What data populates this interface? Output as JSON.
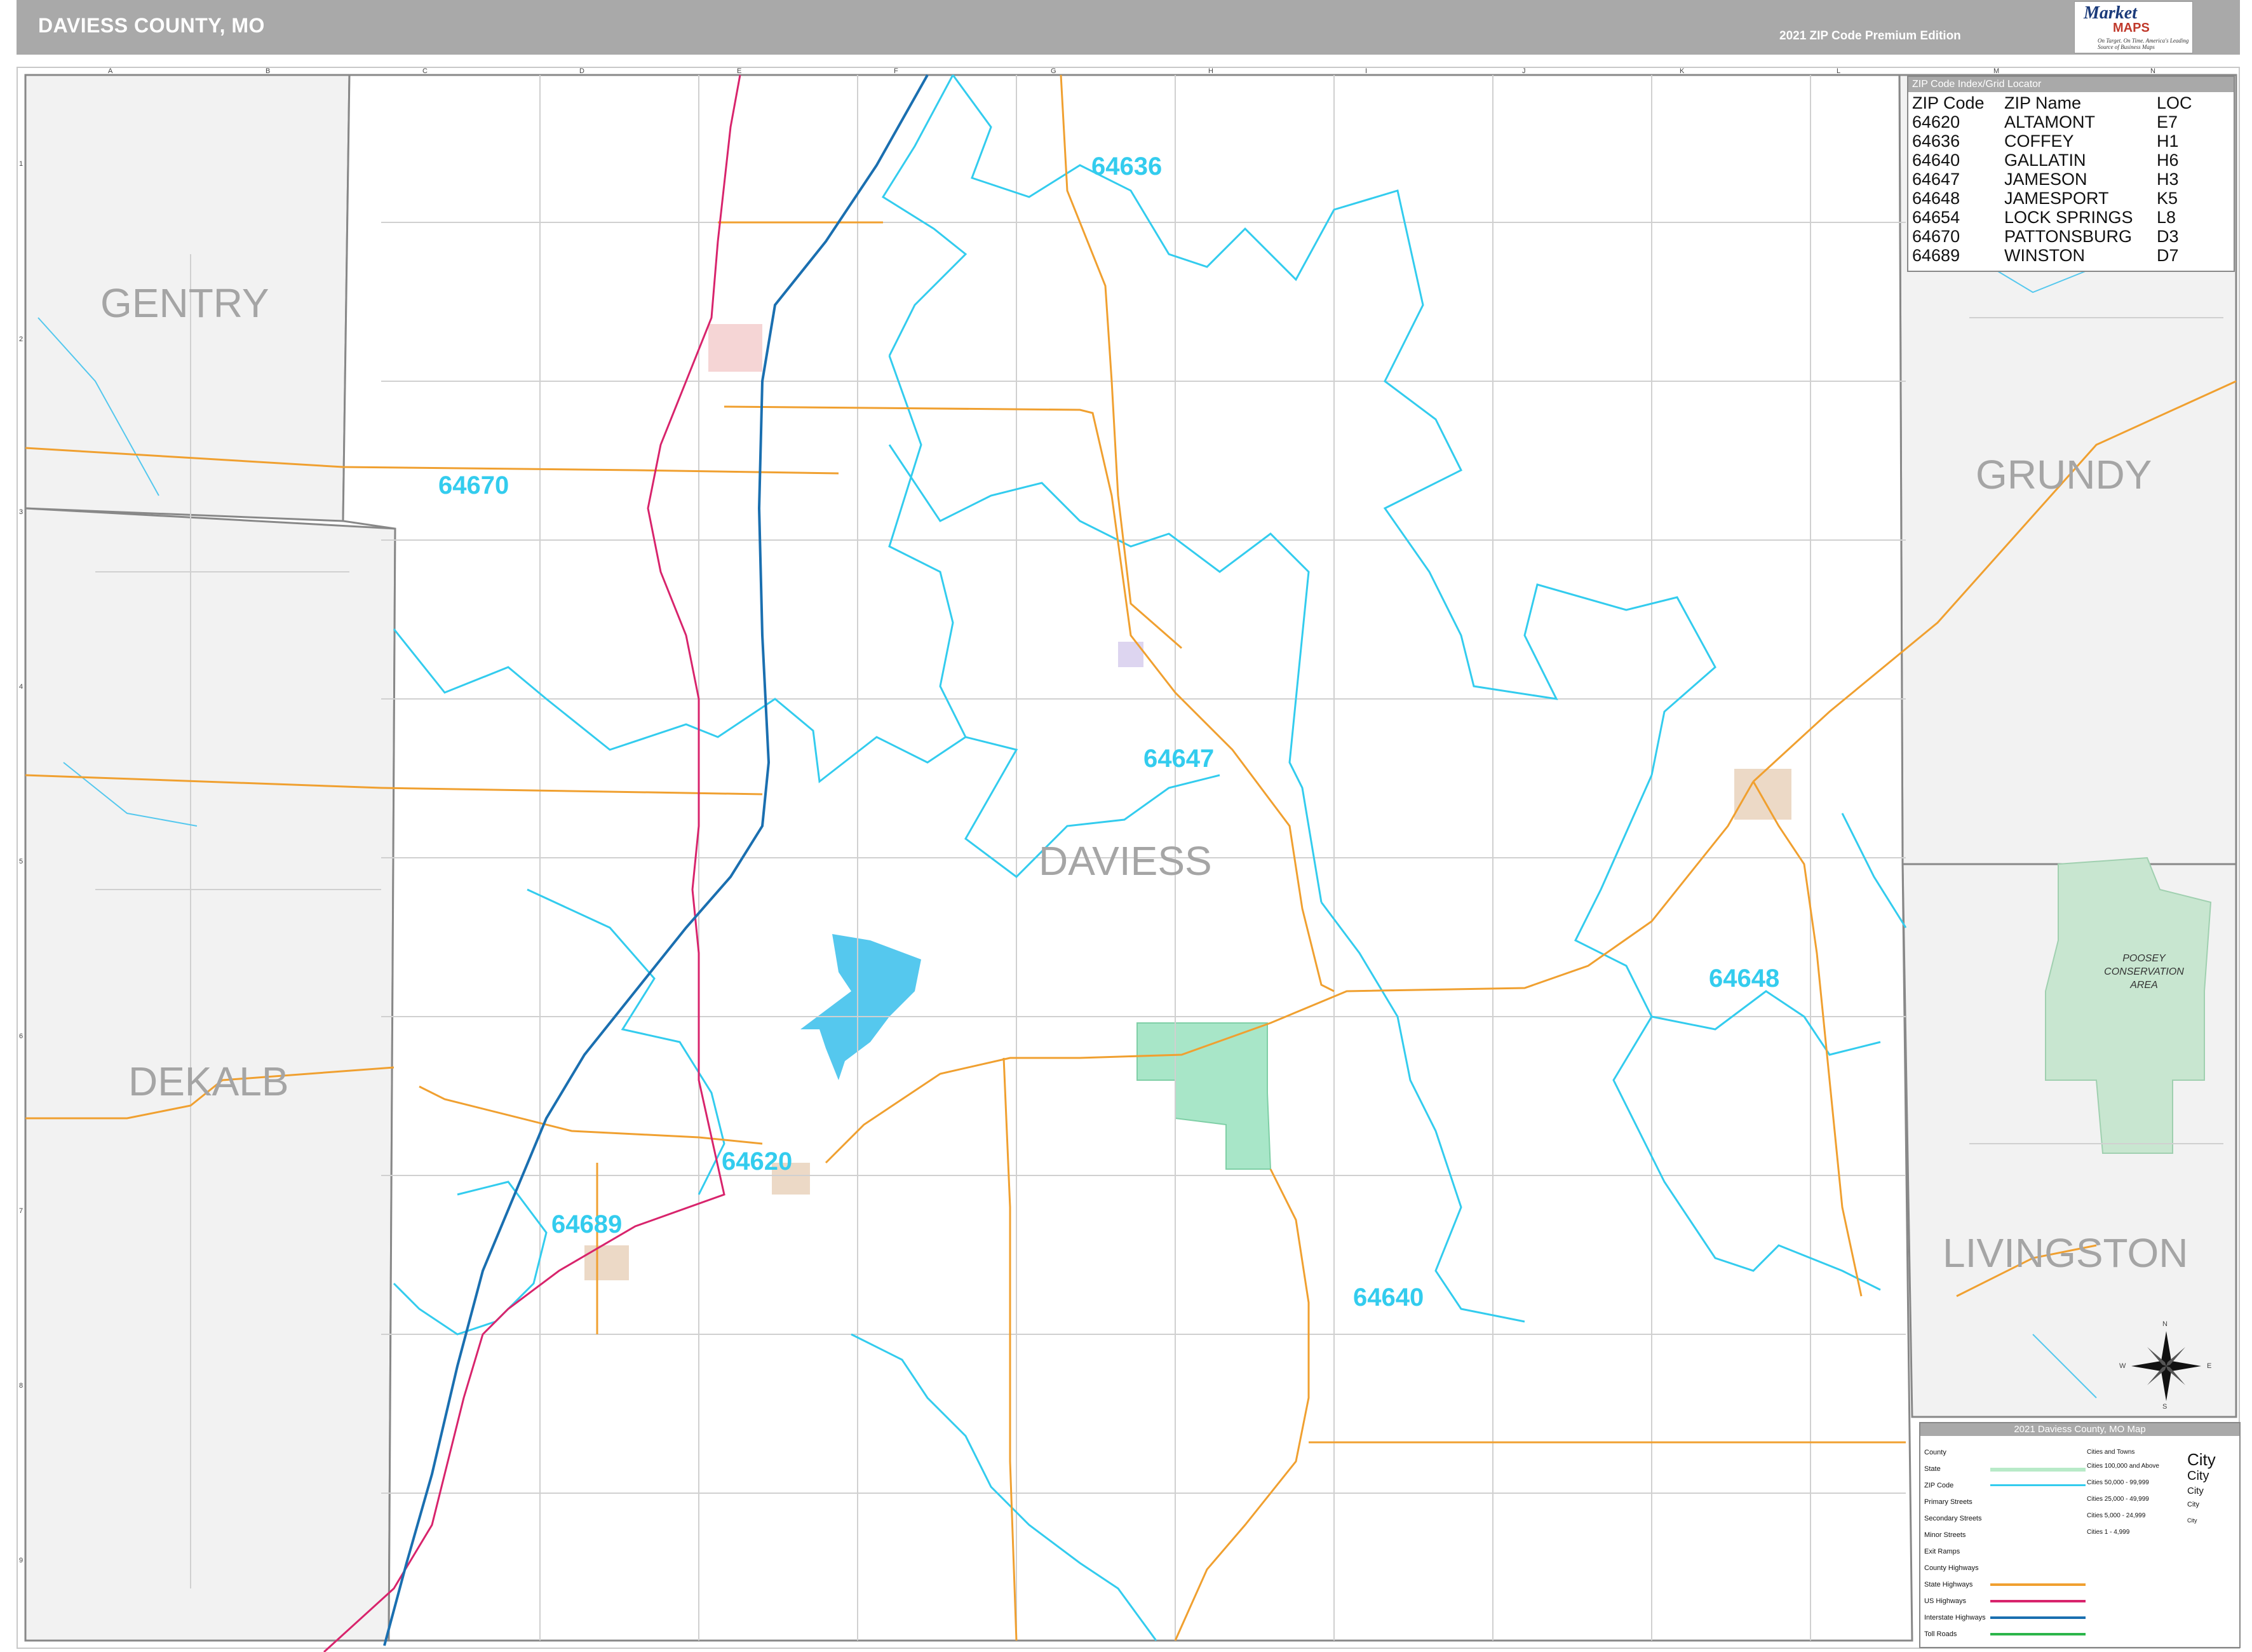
{
  "header": {
    "title": "DAVIESS COUNTY, MO",
    "edition": "2021 ZIP Code Premium Edition",
    "logo_text": "Market",
    "logo_maps": "MAPS",
    "logo_tagline": "On Target. On Time. America's Leading Source of Business Maps"
  },
  "map": {
    "main_county": "DAVIESS",
    "neighbor_counties": [
      "GENTRY",
      "GRUNDY",
      "DEKALB",
      "LIVINGSTON"
    ],
    "area_label": "POOSEY CONSERVATION AREA",
    "zip_labels": [
      "64636",
      "64670",
      "64647",
      "64648",
      "64620",
      "64689",
      "64640"
    ],
    "colors": {
      "zip_boundary": "#33ccee",
      "state_highway": "#f0a030",
      "us_highway": "#d8246c",
      "interstate": "#1a6fb0",
      "county_line": "#888888",
      "conservation": "#c8e6d0",
      "water": "#55c8ee",
      "city_fill": "#a8e6c8"
    }
  },
  "zip_index": {
    "title": "ZIP Code Index/Grid Locator",
    "columns": [
      "ZIP Code",
      "ZIP Name",
      "LOC"
    ],
    "rows": [
      [
        "64620",
        "ALTAMONT",
        "E7"
      ],
      [
        "64636",
        "COFFEY",
        "H1"
      ],
      [
        "64640",
        "GALLATIN",
        "H6"
      ],
      [
        "64647",
        "JAMESON",
        "H3"
      ],
      [
        "64648",
        "JAMESPORT",
        "K5"
      ],
      [
        "64654",
        "LOCK SPRINGS",
        "L8"
      ],
      [
        "64670",
        "PATTONSBURG",
        "D3"
      ],
      [
        "64689",
        "WINSTON",
        "D7"
      ]
    ]
  },
  "legend": {
    "title": "2021 Daviess County, MO Map",
    "items": [
      "County",
      "State",
      "ZIP Code",
      "Primary Streets",
      "Secondary Streets",
      "Minor Streets",
      "Exit Ramps",
      "County Highways",
      "State Highways",
      "US Highways",
      "Interstate Highways",
      "Toll Roads"
    ],
    "city_sizes": [
      "Cities and Towns",
      "Cities 100,000 and Above",
      "Cities 50,000 - 99,999",
      "Cities 25,000 - 49,999",
      "Cities 5,000 - 24,999",
      "Cities 1 - 4,999"
    ],
    "city_samples": [
      "City",
      "City",
      "City",
      "City",
      "City"
    ]
  },
  "compass": {
    "n": "N",
    "s": "S",
    "e": "E",
    "w": "W"
  },
  "grid": {
    "columns": [
      "A",
      "B",
      "C",
      "D",
      "E",
      "F",
      "G",
      "H",
      "I",
      "J",
      "K",
      "L",
      "M",
      "N"
    ],
    "rows": [
      "1",
      "2",
      "3",
      "4",
      "5",
      "6",
      "7",
      "8",
      "9"
    ]
  }
}
